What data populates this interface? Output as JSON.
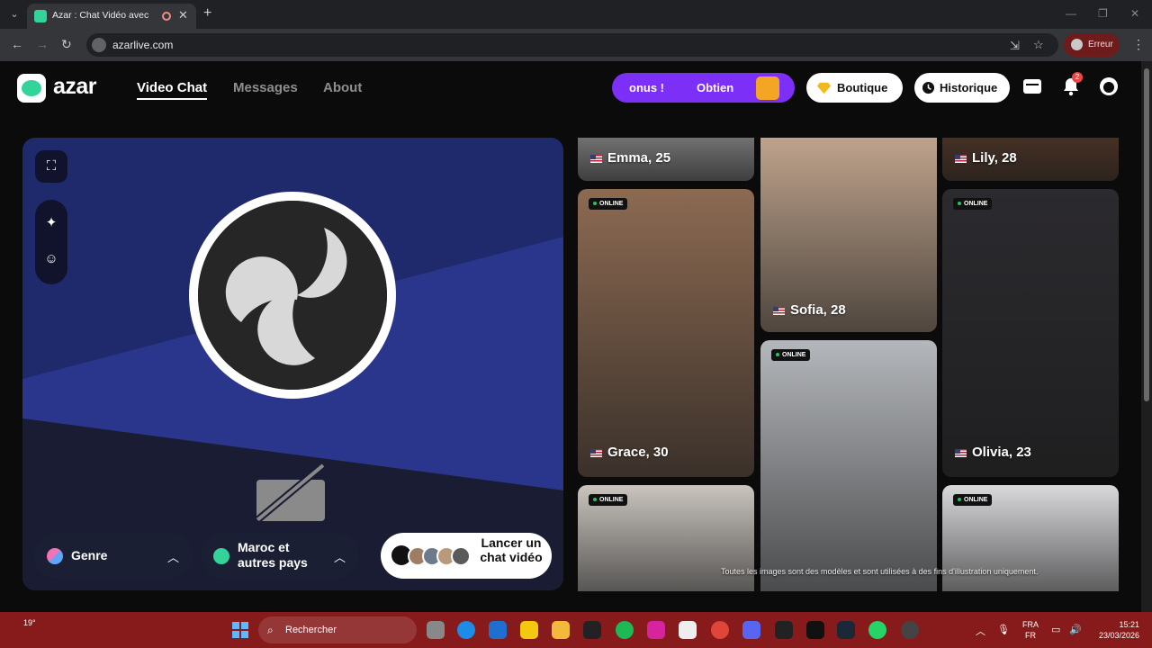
{
  "browser": {
    "tab_title": "Azar : Chat Vidéo avec de n",
    "url": "azarlive.com",
    "error_label": "Erreur"
  },
  "header": {
    "logo_text": "azar",
    "nav": [
      {
        "label": "Video Chat",
        "active": true
      },
      {
        "label": "Messages",
        "active": false
      },
      {
        "label": "About",
        "active": false
      }
    ],
    "promo_text": "onus !",
    "promo_action": "Obtien",
    "shop_label": "Boutique",
    "history_label": "Historique",
    "notification_count": "2"
  },
  "video_panel": {
    "gender_label": "Genre",
    "region_label": "Maroc et autres pays",
    "launch_label": "Lancer un chat vidéo"
  },
  "profiles": [
    {
      "name": "Emma, 25",
      "online": false,
      "color": "#9a9a9a"
    },
    {
      "name": "Sofia, 28",
      "online": false,
      "color": "#d3b49a"
    },
    {
      "name": "Lily, 28",
      "online": false,
      "color": "#5a3b2a"
    },
    {
      "name": "Grace, 30",
      "online": true,
      "color": "#8c6a52"
    },
    {
      "name": "",
      "online": true,
      "color": "#b4b7bb"
    },
    {
      "name": "Olivia, 23",
      "online": true,
      "color": "#2b2a2e"
    },
    {
      "name": "",
      "online": true,
      "color": "#c9c4be"
    },
    {
      "name": "",
      "online": true,
      "color": "#d9d9dc"
    }
  ],
  "online_label": "ONLINE",
  "disclaimer": "Toutes les images sont des modèles et sont utilisées à des fins d'illustration uniquement.",
  "taskbar": {
    "temperature": "19°",
    "search_placeholder": "Rechercher",
    "lang_top": "FRA",
    "lang_bottom": "FR",
    "time": "15:21",
    "date": "23/03/2026"
  }
}
